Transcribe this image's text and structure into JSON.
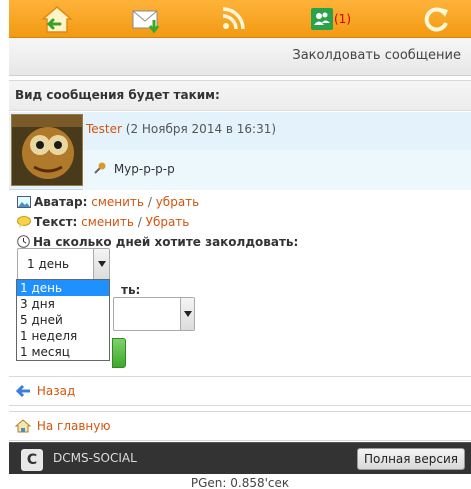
{
  "nav": {
    "home_icon": "home-icon",
    "mail_icon": "mail-icon",
    "rss_icon": "rss-icon",
    "friends_icon": "friends-icon",
    "friends_count": "(1)",
    "refresh_icon": "refresh-icon"
  },
  "header": {
    "title": "Заколдовать сообщение"
  },
  "preview": {
    "heading": "Вид сообщения будет таким:",
    "author": "Tester",
    "date": "(2 Ноября 2014 в 16:31)",
    "message": "Мур-р-р-р"
  },
  "options": {
    "avatar_label": "Аватар:",
    "avatar_change": "сменить",
    "avatar_remove": "убрать",
    "text_label": "Текст:",
    "text_change": "сменить",
    "text_remove": "Убрать",
    "days_label": "На сколько дней хотите заколдовать:",
    "days_selected": "1 день",
    "days_options": [
      "1 день",
      "3 дня",
      "5 дней",
      "1 неделя",
      "1 месяц"
    ],
    "partial_label": "ть:"
  },
  "links": {
    "back": "Назад",
    "home": "На главную"
  },
  "footer": {
    "logo": "C",
    "brand": "DCMS-SOCIAL",
    "full_version": "Полная версия",
    "pgen": "PGen: 0.858'сек"
  },
  "colors": {
    "nav_orange": "#f4a11f",
    "link": "#d2560e",
    "selected": "#1e90ff"
  }
}
